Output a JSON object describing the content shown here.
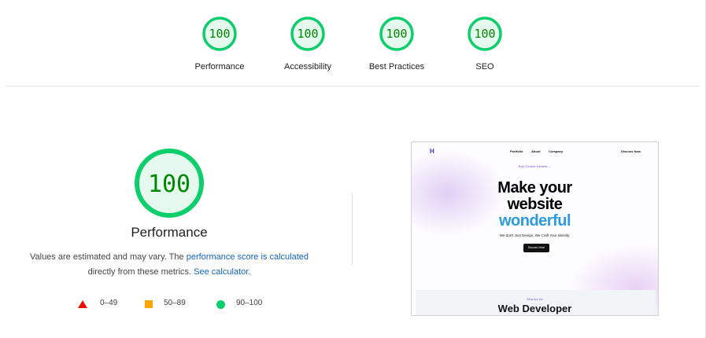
{
  "top_gauges": [
    {
      "label": "Performance",
      "score": "100"
    },
    {
      "label": "Accessibility",
      "score": "100"
    },
    {
      "label": "Best Practices",
      "score": "100"
    },
    {
      "label": "SEO",
      "score": "100"
    }
  ],
  "performance": {
    "score": "100",
    "title": "Performance",
    "desc_1": "Values are estimated and may vary. The ",
    "desc_link": "performance score is calculated",
    "desc_2": "directly from these metrics. ",
    "desc_link2": "See calculator",
    "desc_end": "."
  },
  "legend": {
    "fail": "0–49",
    "average": "50–89",
    "pass": "90–100"
  },
  "screenshot": {
    "logo": "H",
    "nav": [
      "Portfolio",
      "About",
      "Company"
    ],
    "cta_nav": "Discuss Now",
    "pill": "Build Creative Websites →",
    "headline_1": "Make your",
    "headline_2": "website",
    "headline_3": "wonderful",
    "subline": "We don't Just Design, We Craft Your Identity.",
    "button": "Discuss Now!",
    "section_kicker": "What Are We",
    "section_title": "Web Developer"
  },
  "colors": {
    "pass": "#0cce6b",
    "pass_text": "#008800",
    "gauge_fill": "#e5f9ee",
    "average": "#ffa400",
    "fail": "#eb0f00",
    "link": "#1565c0"
  }
}
